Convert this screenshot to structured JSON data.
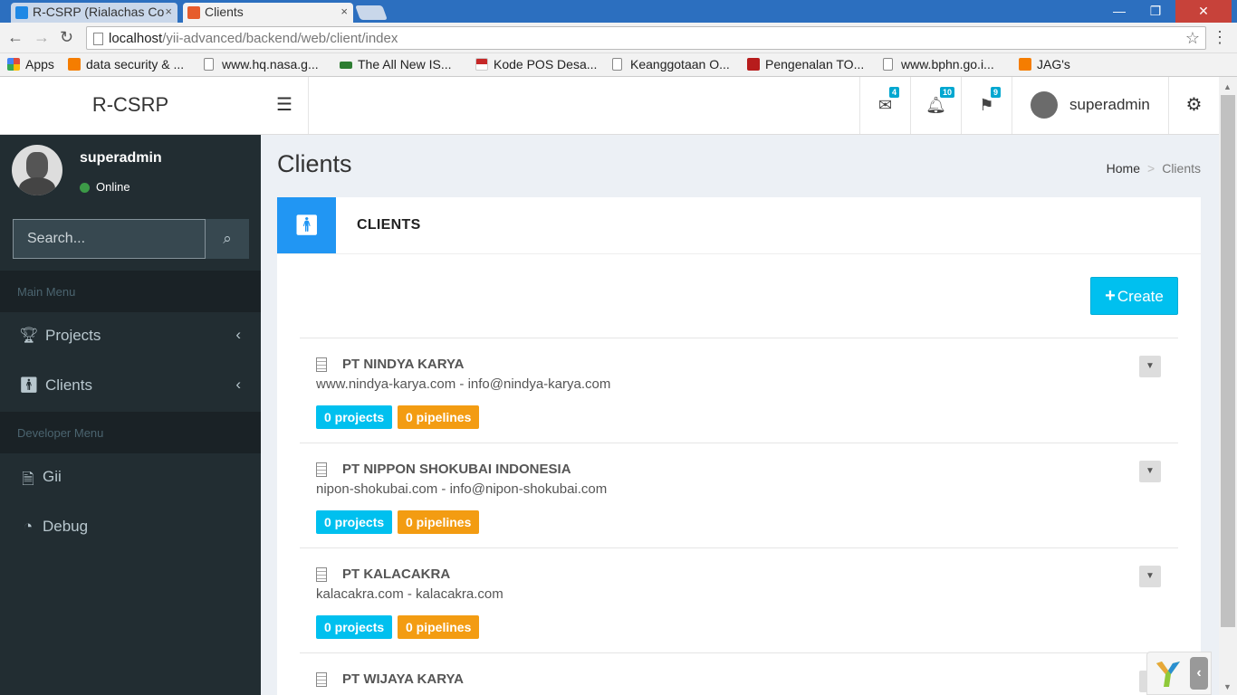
{
  "browser": {
    "tabs": [
      {
        "title": "R-CSRP (Rialachas Co",
        "close": "×"
      },
      {
        "title": "Clients",
        "close": "×"
      }
    ],
    "url_host": "localhost",
    "url_path": "/yii-advanced/backend/web/client/index",
    "window_controls": {
      "minimize": "—",
      "maximize": "❐",
      "close": "✕"
    },
    "bookmarks": [
      {
        "label": "Apps",
        "color": "#e04b3a"
      },
      {
        "label": "data security & ...",
        "color": "#f57d00"
      },
      {
        "label": "www.hq.nasa.g...",
        "color": "#ffffff"
      },
      {
        "label": "The All New IS...",
        "color": "#2e7d32"
      },
      {
        "label": "Kode POS Desa...",
        "color": "#c62828"
      },
      {
        "label": "Keanggotaan O...",
        "color": "#ffffff"
      },
      {
        "label": "Pengenalan TO...",
        "color": "#b71c1c"
      },
      {
        "label": "www.bphn.go.i...",
        "color": "#ffffff"
      },
      {
        "label": "JAG's",
        "color": "#f57d00"
      }
    ]
  },
  "app": {
    "logo": "R-CSRP",
    "notifications": [
      {
        "icon": "envelope-icon",
        "count": "4"
      },
      {
        "icon": "bell-icon",
        "count": "10"
      },
      {
        "icon": "flag-icon",
        "count": "9"
      }
    ],
    "user": {
      "name": "superadmin",
      "status": "Online"
    }
  },
  "sidebar": {
    "search_placeholder": "Search...",
    "main_menu_header": "Main Menu",
    "developer_menu_header": "Developer Menu",
    "main_items": [
      {
        "label": "Projects",
        "icon": "trophy-icon"
      },
      {
        "label": "Clients",
        "icon": "male-icon"
      }
    ],
    "dev_items": [
      {
        "label": "Gii",
        "icon": "file-code-icon"
      },
      {
        "label": "Debug",
        "icon": "dashboard-icon"
      }
    ]
  },
  "content": {
    "page_title": "Clients",
    "breadcrumb": {
      "home": "Home",
      "separator": ">",
      "current": "Clients"
    },
    "box_title": "CLIENTS",
    "create_button": "Create",
    "accent_color": "#2196f3"
  },
  "clients": [
    {
      "name": "PT NINDYA KARYA",
      "website": "www.nindya-karya.com",
      "email": "info@nindya-karya.com",
      "projects": "0 projects",
      "pipelines": "0 pipelines"
    },
    {
      "name": "PT NIPPON SHOKUBAI INDONESIA",
      "website": "nipon-shokubai.com",
      "email": "info@nipon-shokubai.com",
      "projects": "0 projects",
      "pipelines": "0 pipelines"
    },
    {
      "name": "PT KALACAKRA",
      "website": "kalacakra.com",
      "email": "kalacakra.com",
      "projects": "0 projects",
      "pipelines": "0 pipelines"
    },
    {
      "name": "PT WIJAYA KARYA",
      "website": "",
      "email": "",
      "projects": "",
      "pipelines": ""
    }
  ]
}
